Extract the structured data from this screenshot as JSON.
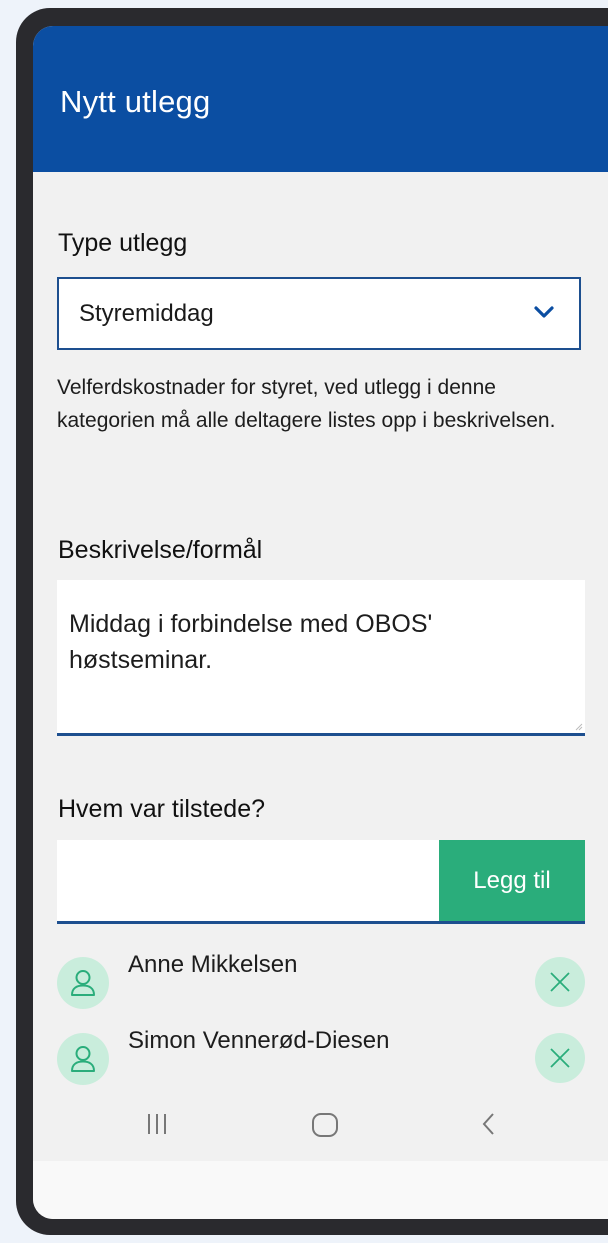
{
  "header": {
    "title": "Nytt utlegg"
  },
  "type_field": {
    "label": "Type utlegg",
    "selected": "Styremiddag",
    "helper": "Velferdskostnader for styret, ved utlegg i denne kategorien må alle deltagere listes opp i beskrivelsen."
  },
  "description_field": {
    "label": "Beskrivelse/formål",
    "value": "Middag i forbindelse med OBOS' høstseminar."
  },
  "attendees": {
    "label": "Hvem var tilstede?",
    "input_value": "",
    "add_label": "Legg til",
    "list": [
      {
        "name": "Anne Mikkelsen"
      },
      {
        "name": "Simon Vennerød-Diesen"
      }
    ]
  },
  "colors": {
    "header": "#0b4ea2",
    "accent_green": "#2aad7b",
    "avatar_bg": "#c9eddc",
    "border_blue": "#1d4f8f"
  },
  "icons": {
    "dropdown": "chevron-down-icon",
    "person": "user-icon",
    "remove": "close-icon",
    "nav_recents": "recent-apps-icon",
    "nav_home": "home-icon",
    "nav_back": "back-icon"
  }
}
